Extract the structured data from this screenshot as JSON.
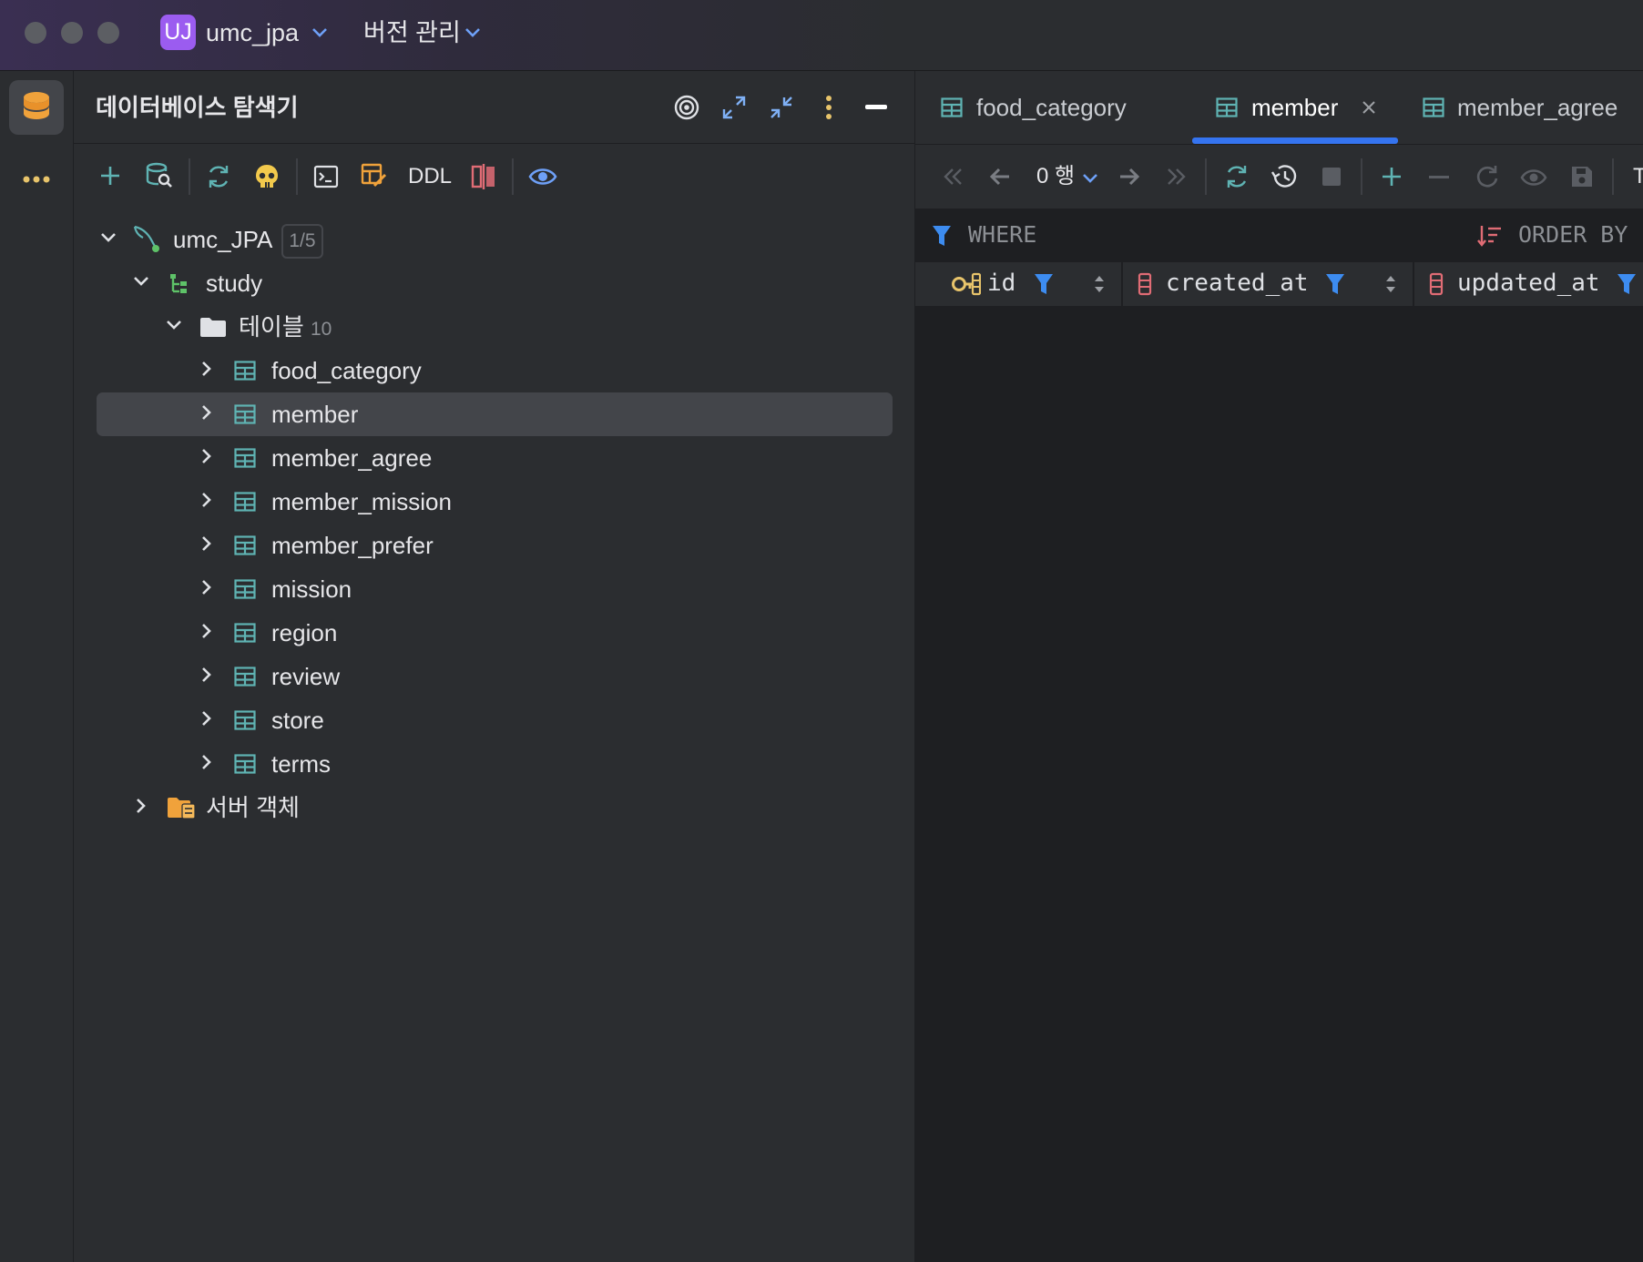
{
  "titlebar": {
    "project_initials": "UJ",
    "project_name": "umc_jpa",
    "vcs_label": "버전 관리"
  },
  "explorer": {
    "title": "데이터베이스 탐색기",
    "toolbar": {
      "ddl_label": "DDL"
    },
    "connection": {
      "name": "umc_JPA",
      "count": "1/5"
    },
    "schema": {
      "name": "study"
    },
    "tables_folder": {
      "label": "테이블",
      "count": "10"
    },
    "tables": [
      {
        "name": "food_category"
      },
      {
        "name": "member"
      },
      {
        "name": "member_agree"
      },
      {
        "name": "member_mission"
      },
      {
        "name": "member_prefer"
      },
      {
        "name": "mission"
      },
      {
        "name": "region"
      },
      {
        "name": "review"
      },
      {
        "name": "store"
      },
      {
        "name": "terms"
      }
    ],
    "selected_table": "member",
    "server_objects": {
      "label": "서버 객체"
    }
  },
  "editor": {
    "tabs": [
      {
        "label": "food_category",
        "active": false
      },
      {
        "label": "member",
        "active": true
      },
      {
        "label": "member_agree",
        "active": false
      }
    ],
    "toolbar": {
      "rows_label": "0 행",
      "truncated_label": "T"
    },
    "filter": {
      "where_label": "WHERE",
      "order_by_label": "ORDER BY"
    },
    "columns": [
      {
        "name": "id",
        "icon": "primary-key-icon"
      },
      {
        "name": "created_at",
        "icon": "column-icon"
      },
      {
        "name": "updated_at",
        "icon": "column-icon"
      }
    ]
  },
  "colors": {
    "accent": "#3574f0",
    "table_icon": "#5fb3b3",
    "key_icon": "#e8c46b",
    "column_icon": "#e06c75",
    "project_badge": "#9b5cf0"
  }
}
